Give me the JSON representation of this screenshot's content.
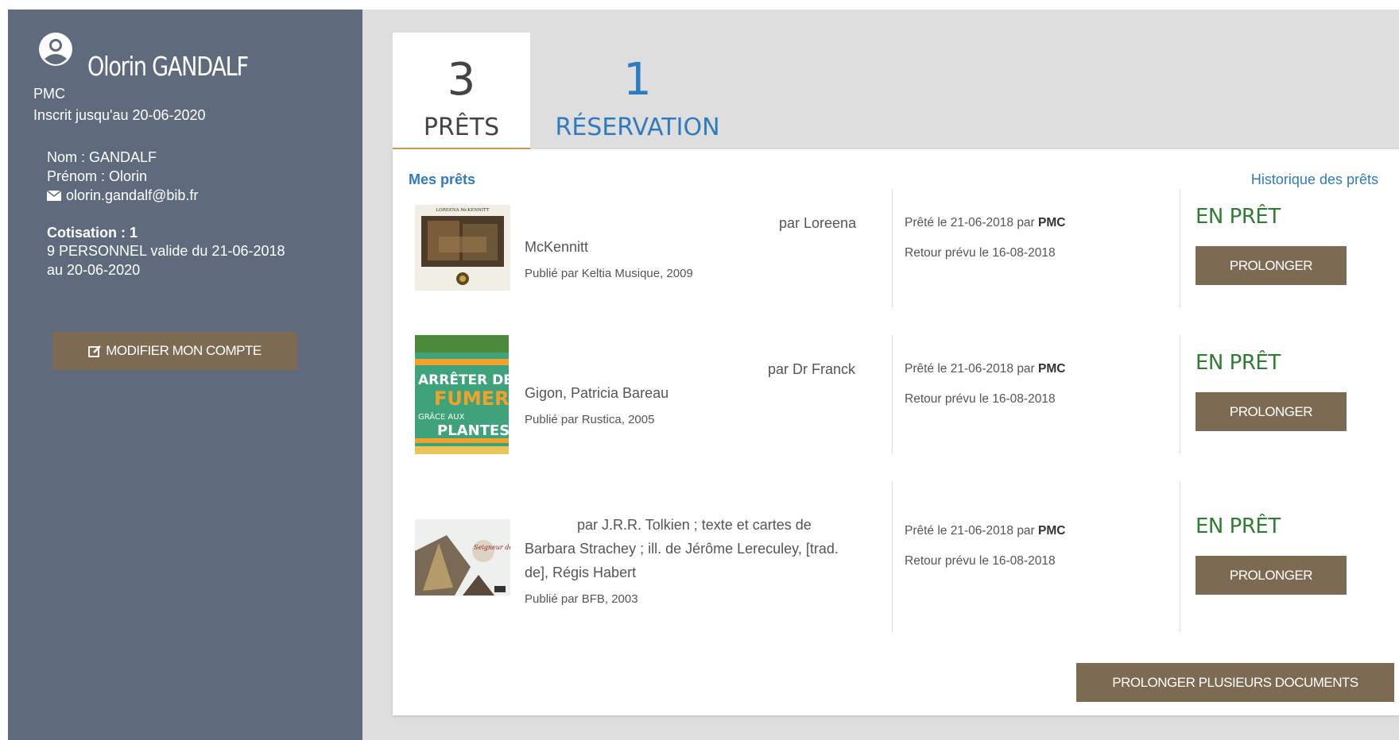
{
  "user": {
    "name": "Olorin GANDALF",
    "site": "PMC",
    "registered_until": "Inscrit jusqu'au 20-06-2020",
    "nom": "Nom : GANDALF",
    "prenom": "Prénom : Olorin",
    "email": "olorin.gandalf@bib.fr",
    "cotisation_title": "Cotisation : 1",
    "cotisation_line1": "9 PERSONNEL valide du 21-06-2018",
    "cotisation_line2": "au 20-06-2020",
    "modify_label": "MODIFIER MON COMPTE"
  },
  "tabs": [
    {
      "count": "3",
      "label": "PRÊTS"
    },
    {
      "count": "1",
      "label": "RÉSERVATION"
    }
  ],
  "panel": {
    "title": "Mes prêts",
    "history_link": "Historique des prêts",
    "multi_prolong_label": "PROLONGER PLUSIEURS DOCUMENTS"
  },
  "loans": [
    {
      "authors": "par Loreena McKennitt",
      "publisher": "Publié par Keltia Musique, 2009",
      "loaned": "Prêté le 21-06-2018 par",
      "loaned_site": "PMC",
      "return": "Retour prévu le 16-08-2018",
      "status": "EN PRÊT",
      "button": "PROLONGER",
      "cover_caption": "LOREENA McKENNITT"
    },
    {
      "authors": "par Dr Franck Gigon, Patricia Bareau",
      "publisher": "Publié par Rustica, 2005",
      "loaned": "Prêté le 21-06-2018 par",
      "loaned_site": "PMC",
      "return": "Retour prévu le 16-08-2018",
      "status": "EN PRÊT",
      "button": "PROLONGER",
      "cover_line1": "ARRÊTER DE",
      "cover_line2": "FUMER",
      "cover_line3": "GRÂCE AUX",
      "cover_line4": "PLANTES"
    },
    {
      "authors": "par J.R.R. Tolkien ; texte et cartes de Barbara Strachey ; ill. de Jérôme Lereculey, [trad. de], Régis Habert",
      "publisher": "Publié par BFB, 2003",
      "loaned": "Prêté le 21-06-2018 par",
      "loaned_site": "PMC",
      "return": "Retour prévu le 16-08-2018",
      "status": "EN PRÊT",
      "button": "PROLONGER",
      "cover_caption": "Seigneur des Anneaux"
    }
  ],
  "colors": {
    "sidebar": "#5f6a7d",
    "button": "#7c6a52",
    "link": "#2f7bbf",
    "status": "#2e7d32",
    "tab_underline": "#c89a55"
  }
}
